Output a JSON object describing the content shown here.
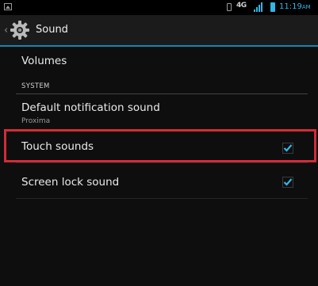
{
  "status_bar": {
    "network": "4G",
    "time": "11:19",
    "time_suffix": "AM"
  },
  "action_bar": {
    "title": "Sound"
  },
  "list": {
    "volumes_label": "Volumes",
    "section_header": "SYSTEM",
    "notification_label": "Default notification sound",
    "notification_value": "Proxima",
    "touch_sounds_label": "Touch sounds",
    "touch_sounds_checked": true,
    "screen_lock_label": "Screen lock sound",
    "screen_lock_checked": true
  },
  "colors": {
    "accent": "#33b5e5",
    "divider_accent": "#1d84ad",
    "highlight": "#d32c35"
  }
}
